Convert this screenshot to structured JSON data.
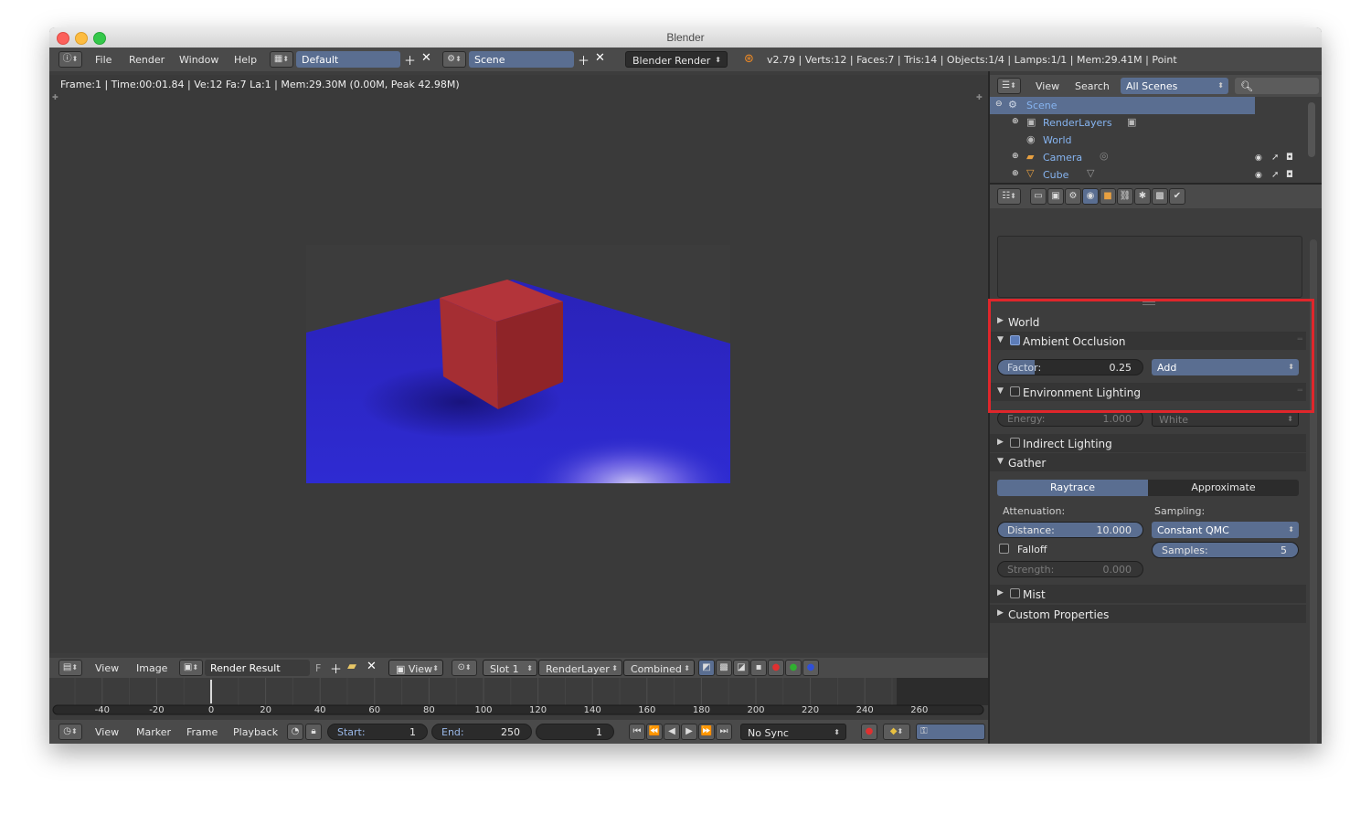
{
  "window": {
    "title": "Blender"
  },
  "topbar": {
    "menus": [
      "File",
      "Render",
      "Window",
      "Help"
    ],
    "screen_layout": "Default",
    "scene": "Scene",
    "engine": "Blender Render",
    "stats": "v2.79 | Verts:12 | Faces:7 | Tris:14 | Objects:1/4 | Lamps:1/1 | Mem:29.41M | Point"
  },
  "image_editor": {
    "frame_info": "Frame:1 | Time:00:01.84 | Ve:12 Fa:7 La:1 | Mem:29.30M (0.00M, Peak 42.98M)",
    "header": {
      "menus": [
        "View",
        "Image"
      ],
      "image_name": "Render Result",
      "fake_user": "F",
      "view_menu": "View",
      "slot": "Slot 1",
      "render_layer": "RenderLayer",
      "pass": "Combined"
    },
    "render_colors": {
      "floor": "#2424c8",
      "cube": "#b3343a",
      "background": "#3c3c3c"
    }
  },
  "timeline": {
    "ticks": [
      "-40",
      "-20",
      "0",
      "20",
      "40",
      "60",
      "80",
      "100",
      "120",
      "140",
      "160",
      "180",
      "200",
      "220",
      "240",
      "260"
    ],
    "current_frame_marker": 1,
    "header": {
      "menus": [
        "View",
        "Marker",
        "Frame",
        "Playback"
      ],
      "start_label": "Start:",
      "start_value": "1",
      "end_label": "End:",
      "end_value": "250",
      "current_value": "1",
      "sync": "No Sync"
    }
  },
  "outliner": {
    "menus": [
      "View",
      "Search"
    ],
    "filter": "All Scenes",
    "items": [
      {
        "label": "Scene"
      },
      {
        "label": "RenderLayers"
      },
      {
        "label": "World"
      },
      {
        "label": "Camera"
      },
      {
        "label": "Cube"
      }
    ]
  },
  "properties": {
    "panels": {
      "world": "World",
      "ao": {
        "title": "Ambient Occlusion",
        "enabled": true,
        "factor_label": "Factor:",
        "factor_value": "0.25",
        "factor_fraction": 0.25,
        "blend_mode": "Add"
      },
      "env": {
        "title": "Environment Lighting",
        "enabled": false,
        "energy_label": "Energy:",
        "energy_value": "1.000",
        "color": "White"
      },
      "indirect": "Indirect Lighting",
      "gather": {
        "title": "Gather",
        "tab_raytrace": "Raytrace",
        "tab_approximate": "Approximate",
        "attenuation_label": "Attenuation:",
        "sampling_label": "Sampling:",
        "distance_label": "Distance:",
        "distance_value": "10.000",
        "sampling_method": "Constant QMC",
        "falloff_label": "Falloff",
        "samples_label": "Samples:",
        "samples_value": "5",
        "strength_label": "Strength:",
        "strength_value": "0.000"
      },
      "mist": "Mist",
      "custom": "Custom Properties"
    }
  },
  "colors": {
    "accent": "#5a6e91",
    "highlight_box": "#e0262b",
    "outliner_text": "#86b4f0"
  }
}
